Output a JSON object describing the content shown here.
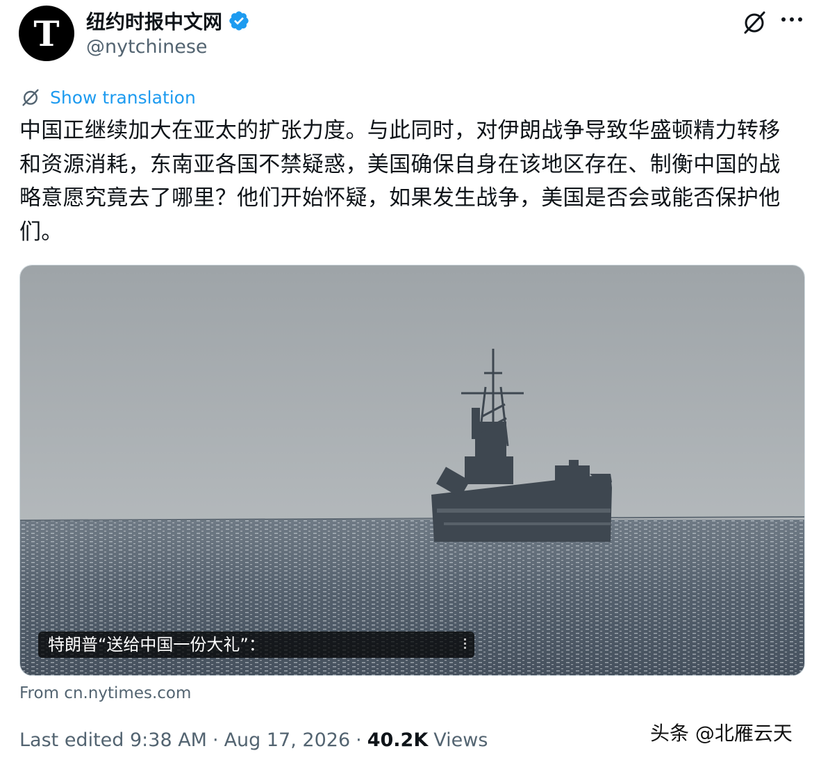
{
  "header": {
    "display_name": "纽约时报中文网",
    "handle": "@nytchinese",
    "avatar_letter": "T",
    "verified_color": "#1d9bf0"
  },
  "actions": {
    "grok_icon": "grok-slash-circle-icon",
    "more_icon": "more-horizontal-icon"
  },
  "translation": {
    "label": "Show translation",
    "icon": "grok-slash-circle-icon",
    "color": "#1d9bf0"
  },
  "tweet": {
    "text": "中国正继续加大在亚太的扩张力度。与此同时，对伊朗战争导致华盛顿精力转移和资源消耗，东南亚各国不禁疑惑，美国确保自身在该地区存在、制衡中国的战略意愿究竟去了哪里？他们开始怀疑，如果发生战争，美国是否会或能否保护他们。"
  },
  "media": {
    "caption": "特朗普“送给中国一份大礼”："
  },
  "card_source": "From cn.nytimes.com",
  "meta": {
    "edited": "Last edited 9:38 AM",
    "separator": "·",
    "date": "Aug 17, 2026",
    "views_count": "40.2K",
    "views_label": "Views"
  },
  "watermark": "头条 @北雁云天"
}
